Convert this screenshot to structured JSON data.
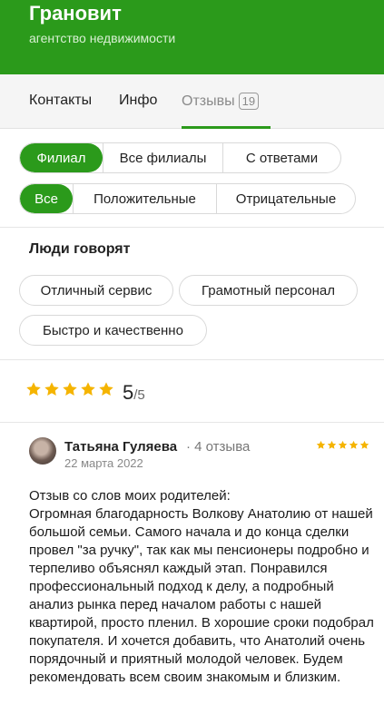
{
  "header": {
    "title": "Гранoвит",
    "subtitle": "агентство недвижимости"
  },
  "tabs": [
    {
      "label": "Контакты"
    },
    {
      "label": "Инфо"
    },
    {
      "label": "Отзывы",
      "count": "19",
      "active": true
    }
  ],
  "filters": {
    "scope": [
      "Филиал",
      "Все филиалы",
      "С ответами"
    ],
    "scope_active": "Филиал",
    "sentiment": [
      "Все",
      "Положительные",
      "Отрицательные"
    ],
    "sentiment_active": "Все"
  },
  "people_say": {
    "title": "Люди говорят",
    "tags": [
      "Отличный сервис",
      "Грамотный персонал",
      "Быстро и качественно"
    ]
  },
  "rating": {
    "value": "5",
    "max": "/5",
    "stars": 5,
    "star_color": "#f5b400"
  },
  "review": {
    "author": "Татьяна Гуляева",
    "meta": "· 4 отзыва",
    "date": "22 марта 2022",
    "stars": 5,
    "text": "Отзыв со слов моих родителей:\nОгромная благодарность Волкову Анатолию от нашей большой семьи. Самого начала и до конца сделки провел \"за ручку\", так как мы пенсионеры подробно и терпеливо объяснял каждый этап. Понравился профессиональный подход к делу, а подробный анализ рынка перед началом работы с нашей квартирой, просто пленил. В хорошие сроки подобрал покупателя. И хочется добавить, что Анатолий очень порядочный и приятный молодой человек. Будем рекомендовать всем своим знакомым и близким."
  },
  "colors": {
    "brand_green": "#2b9a1b"
  }
}
